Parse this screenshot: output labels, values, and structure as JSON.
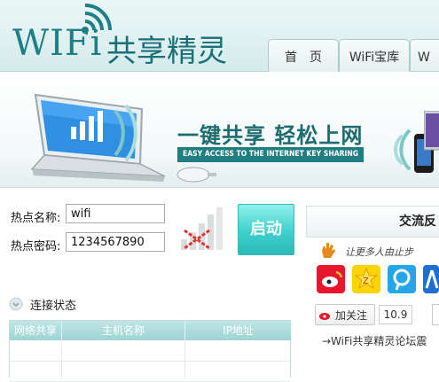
{
  "app": {
    "logo_text": "WIFi",
    "logo_cn": "共享精灵"
  },
  "nav": {
    "tabs": [
      {
        "label": "首　页"
      },
      {
        "label": "WiFi宝库"
      },
      {
        "label": "W"
      }
    ]
  },
  "banner": {
    "slogan": "一键共享 轻松上网",
    "slogan_en": "EASY ACCESS TO THE INTERNET KEY SHARING"
  },
  "form": {
    "hotspot_name_label": "热点名称:",
    "hotspot_name_value": "wifi",
    "hotspot_password_label": "热点密码:",
    "hotspot_password_value": "1234567890",
    "start_button": "启动"
  },
  "status": {
    "title": "连接状态",
    "table_headers": [
      "网络共享",
      "主机名称",
      "IP地址"
    ]
  },
  "side": {
    "header": "交流反",
    "tagline": "让更多人由止步",
    "follow_label": "加关注",
    "follow_count": "10.9",
    "forum_link": "→WiFi共享精灵论坛震"
  },
  "colors": {
    "brand": "#1f7f86",
    "button": "#3fd0cc",
    "table_header": "#9fd3d3"
  }
}
